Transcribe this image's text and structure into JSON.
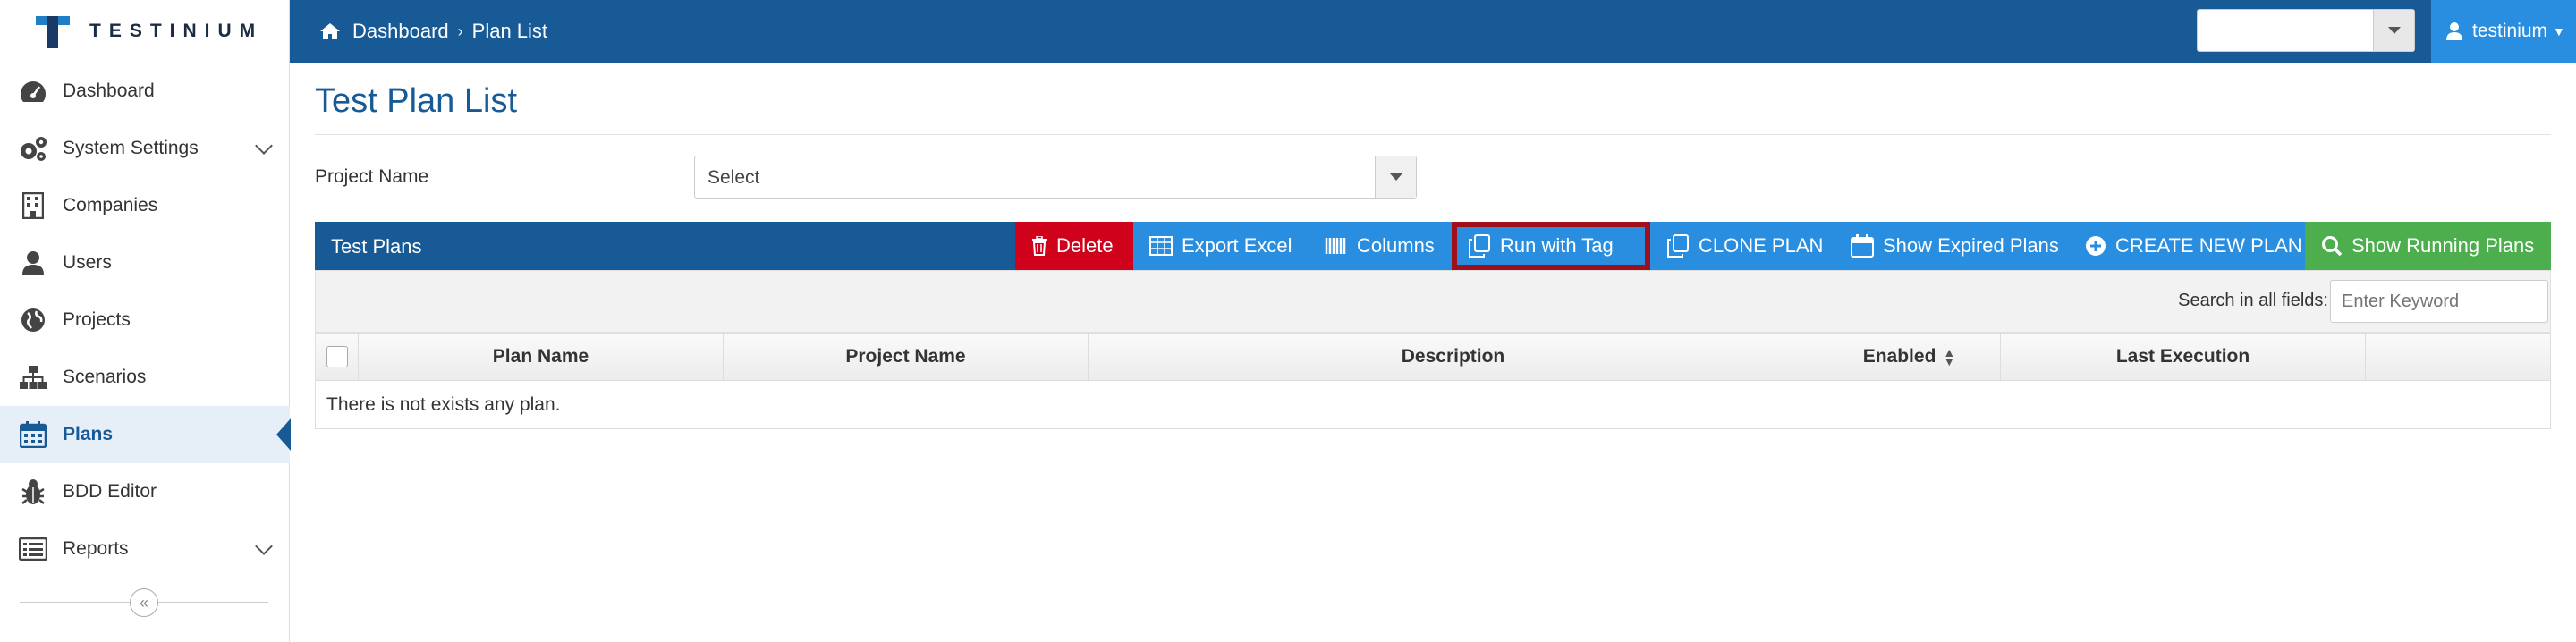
{
  "header": {
    "logo_text": "TESTINIUM",
    "breadcrumb": [
      "Dashboard",
      "Plan List"
    ],
    "project_selector_value": "",
    "user_name": "testinium"
  },
  "sidebar": {
    "items": [
      {
        "label": "Dashboard",
        "icon": "dashboard-icon"
      },
      {
        "label": "System Settings",
        "icon": "gear-icon",
        "expandable": true
      },
      {
        "label": "Companies",
        "icon": "building-icon"
      },
      {
        "label": "Users",
        "icon": "user-icon"
      },
      {
        "label": "Projects",
        "icon": "globe-icon"
      },
      {
        "label": "Scenarios",
        "icon": "sitemap-icon"
      },
      {
        "label": "Plans",
        "icon": "calendar-icon",
        "active": true
      },
      {
        "label": "BDD Editor",
        "icon": "bug-icon"
      },
      {
        "label": "Reports",
        "icon": "list-icon",
        "expandable": true
      }
    ]
  },
  "main": {
    "title": "Test Plan List",
    "project_name_label": "Project Name",
    "project_name_value": "Select",
    "toolbar": {
      "title": "Test Plans",
      "delete": "Delete",
      "export_excel": "Export Excel",
      "columns": "Columns",
      "run_with_tag": "Run with Tag",
      "clone_plan": "CLONE PLAN",
      "show_expired": "Show Expired Plans",
      "create_new": "CREATE NEW PLAN",
      "show_running": "Show Running Plans"
    },
    "search": {
      "label": "Search in all fields:",
      "placeholder": "Enter Keyword"
    },
    "table": {
      "columns": [
        "Plan Name",
        "Project Name",
        "Description",
        "Enabled",
        "Last Execution"
      ],
      "empty_message": "There is not exists any plan."
    }
  },
  "colors": {
    "brand": "#175a96",
    "button": "#2a8ee0",
    "danger": "#d0021b",
    "success": "#4cae4c",
    "highlight": "#a0101a"
  }
}
